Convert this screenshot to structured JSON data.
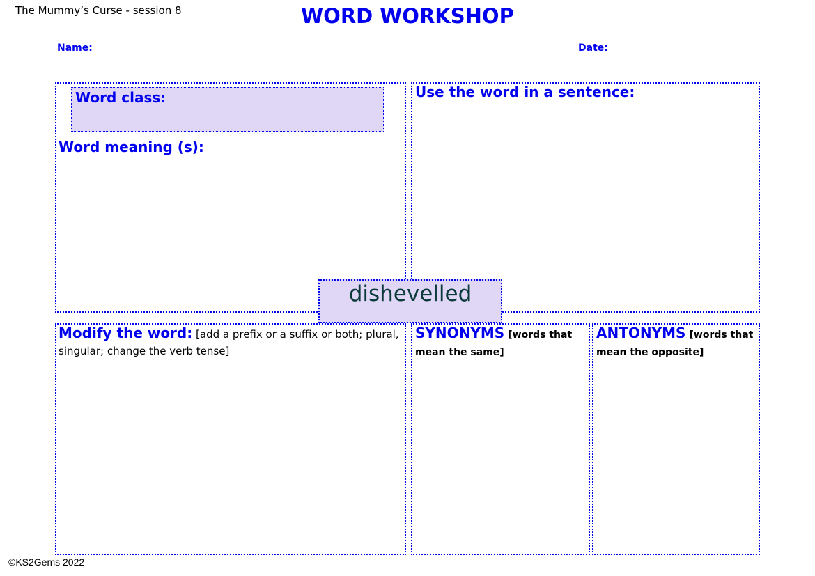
{
  "header": {
    "session": "The Mummy’s Curse - session 8",
    "title": "WORD WORKSHOP",
    "name_label": "Name:",
    "date_label": "Date:"
  },
  "sections": {
    "word_class": {
      "label": "Word class:"
    },
    "word_meaning": {
      "label": "Word meaning (s):"
    },
    "sentence": {
      "label": "Use the word in a sentence:"
    },
    "modify": {
      "label": "Modify the word:",
      "note": "[add a prefix or a suffix or both; plural, singular; change the verb tense]"
    },
    "synonyms": {
      "label": "SYNONYMS",
      "note": "[words that mean the same]"
    },
    "antonyms": {
      "label": "ANTONYMS",
      "note": "[words that mean the opposite]"
    }
  },
  "focus_word": "dishevelled",
  "footer": {
    "copyright": "©KS2Gems 2022"
  },
  "colors": {
    "accent": "#0000ee",
    "highlight_fill": "#dfd7f5",
    "word_color": "#0b3a3a"
  }
}
